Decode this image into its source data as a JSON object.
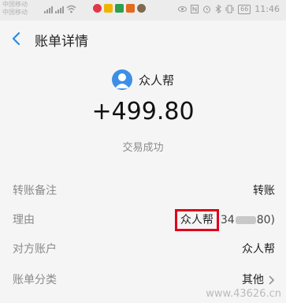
{
  "status_bar": {
    "carrier_1": "中国移动",
    "carrier_2": "中国移动",
    "battery": "66",
    "time": "11:46"
  },
  "header": {
    "title": "账单详情"
  },
  "summary": {
    "merchant_name": "众人帮",
    "amount": "+499.80",
    "status": "交易成功"
  },
  "details": {
    "note_label": "转账备注",
    "note_value": "转账",
    "reason_label": "理由",
    "reason_value": "众人帮",
    "reason_account_prefix": "34",
    "reason_account_suffix": "80)",
    "counterparty_label": "对方账户",
    "counterparty_value": "众人帮",
    "category_label": "账单分类",
    "category_value": "其他"
  },
  "watermark": "www.43626.cn"
}
